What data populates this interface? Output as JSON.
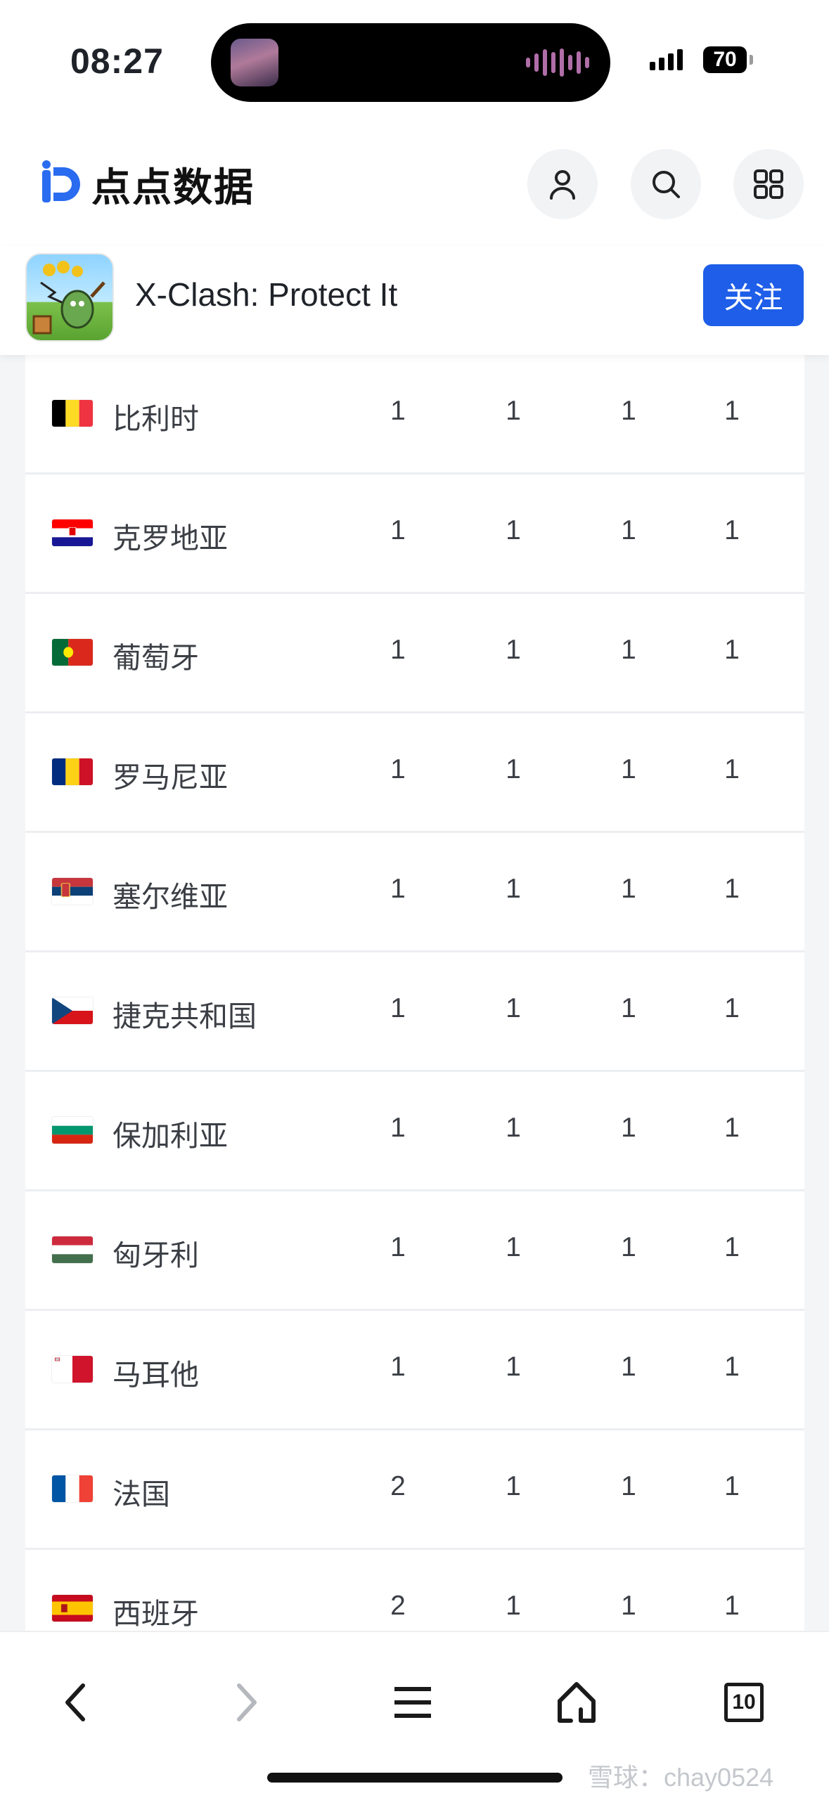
{
  "status_bar": {
    "time": "08:27",
    "battery": "70"
  },
  "site": {
    "logo_text": "点点数据"
  },
  "app": {
    "name": "X-Clash: Protect It",
    "follow_label": "关注"
  },
  "table": {
    "rows": [
      {
        "country": "比利时",
        "flag": "belgium",
        "values": [
          "1",
          "1",
          "1",
          "1"
        ]
      },
      {
        "country": "克罗地亚",
        "flag": "croatia",
        "values": [
          "1",
          "1",
          "1",
          "1"
        ]
      },
      {
        "country": "葡萄牙",
        "flag": "portugal",
        "values": [
          "1",
          "1",
          "1",
          "1"
        ]
      },
      {
        "country": "罗马尼亚",
        "flag": "romania",
        "values": [
          "1",
          "1",
          "1",
          "1"
        ]
      },
      {
        "country": "塞尔维亚",
        "flag": "serbia",
        "values": [
          "1",
          "1",
          "1",
          "1"
        ]
      },
      {
        "country": "捷克共和国",
        "flag": "czech",
        "values": [
          "1",
          "1",
          "1",
          "1"
        ]
      },
      {
        "country": "保加利亚",
        "flag": "bulgaria",
        "values": [
          "1",
          "1",
          "1",
          "1"
        ]
      },
      {
        "country": "匈牙利",
        "flag": "hungary",
        "values": [
          "1",
          "1",
          "1",
          "1"
        ]
      },
      {
        "country": "马耳他",
        "flag": "malta",
        "values": [
          "1",
          "1",
          "1",
          "1"
        ]
      },
      {
        "country": "法国",
        "flag": "france",
        "values": [
          "2",
          "1",
          "1",
          "1"
        ]
      },
      {
        "country": "西班牙",
        "flag": "spain",
        "values": [
          "2",
          "1",
          "1",
          "1"
        ]
      }
    ]
  },
  "bottom_nav": {
    "tabs_count": "10"
  },
  "watermark": "雪球：chay0524",
  "colors": {
    "accent": "#1e5ee8",
    "text": "#3b3f45",
    "divider": "#eceef1"
  }
}
